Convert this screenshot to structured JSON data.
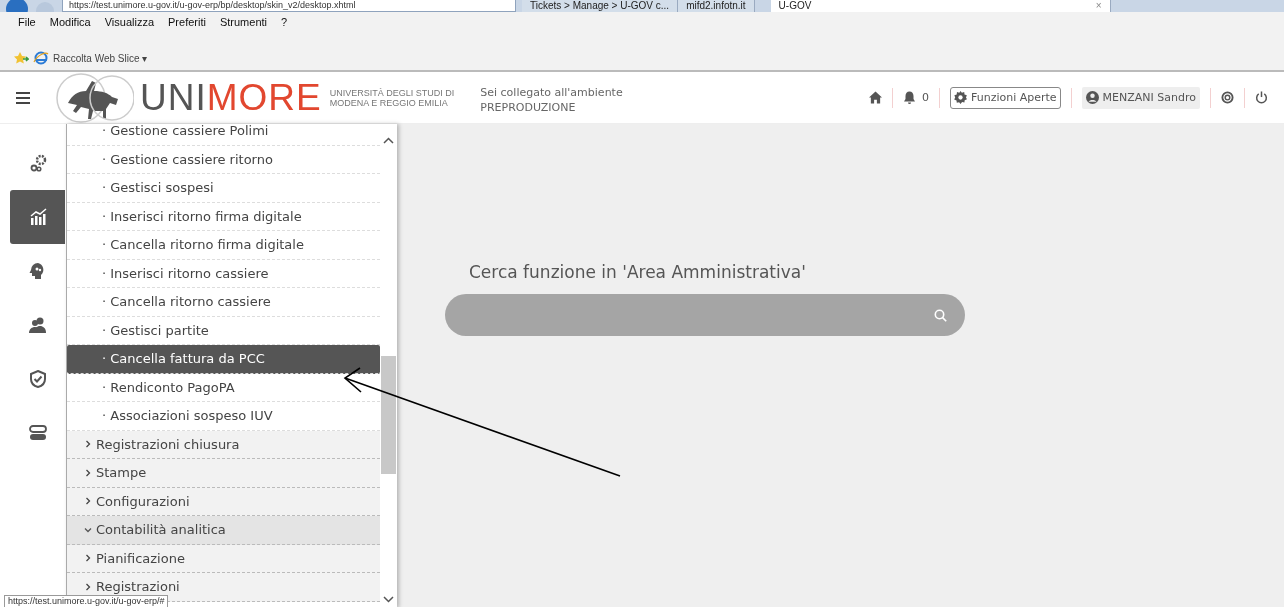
{
  "browser": {
    "address": "https://test.unimore.u-gov.it/u-gov-erp/bp/desktop/skin_v2/desktop.xhtml",
    "tabs": [
      {
        "label": "Tickets > Manage > U-GOV c...",
        "selected": false
      },
      {
        "label": "mifd2.infotn.it",
        "selected": false
      },
      {
        "label": "U-GOV",
        "selected": true
      }
    ],
    "close": "×",
    "menu": [
      "File",
      "Modifica",
      "Visualizza",
      "Preferiti",
      "Strumenti",
      "?"
    ],
    "favorites": "Raccolta Web Slice ▾"
  },
  "header": {
    "logo": {
      "part_1": "UNI",
      "part_2": "MORE",
      "subtitle": [
        "UNIVERSITÀ DEGLI STUDI DI",
        "MODENA E REGGIO EMILIA"
      ]
    },
    "environment": [
      "Sei collegato all'ambiente",
      "PREPRODUZIONE"
    ],
    "notifications": "0",
    "open_functions": "Funzioni Aperte",
    "user": "MENZANI Sandro"
  },
  "rail": [
    {
      "kind": "gears",
      "selected": false
    },
    {
      "kind": "chart",
      "selected": true
    },
    {
      "kind": "head",
      "selected": false
    },
    {
      "kind": "people",
      "selected": false
    },
    {
      "kind": "shield",
      "selected": false
    },
    {
      "kind": "toggles",
      "selected": false
    }
  ],
  "menu_items": [
    {
      "kind": "leaf",
      "label": "· Gestione cassiere Polimi",
      "selected": false
    },
    {
      "kind": "leaf",
      "label": "· Gestione cassiere ritorno",
      "selected": false
    },
    {
      "kind": "leaf",
      "label": "· Gestisci sospesi",
      "selected": false
    },
    {
      "kind": "leaf",
      "label": "· Inserisci ritorno firma digitale",
      "selected": false
    },
    {
      "kind": "leaf",
      "label": "· Cancella ritorno firma digitale",
      "selected": false
    },
    {
      "kind": "leaf",
      "label": "· Inserisci ritorno cassiere",
      "selected": false
    },
    {
      "kind": "leaf",
      "label": "· Cancella ritorno cassiere",
      "selected": false
    },
    {
      "kind": "leaf",
      "label": "· Gestisci partite",
      "selected": false
    },
    {
      "kind": "leaf",
      "label": "· Cancella fattura da PCC",
      "selected": true
    },
    {
      "kind": "leaf",
      "label": "· Rendiconto PagoPA",
      "selected": false
    },
    {
      "kind": "leaf",
      "label": "· Associazioni sospeso IUV",
      "selected": false
    },
    {
      "kind": "group",
      "label": "Registrazioni chiusura",
      "selected": false,
      "expanded": false
    },
    {
      "kind": "group",
      "label": "Stampe",
      "selected": false,
      "expanded": false
    },
    {
      "kind": "group",
      "label": "Configurazioni",
      "selected": false,
      "expanded": false
    },
    {
      "kind": "group",
      "label": "Contabilità analitica",
      "selected": false,
      "expanded": true
    },
    {
      "kind": "group",
      "label": "Pianificazione",
      "selected": false,
      "expanded": false
    },
    {
      "kind": "group",
      "label": "Registrazioni",
      "selected": false,
      "expanded": false
    }
  ],
  "search": {
    "label": "Cerca funzione in 'Area Amministrativa'"
  },
  "status_url": "https://test.unimore.u-gov.it/u-gov-erp/#"
}
